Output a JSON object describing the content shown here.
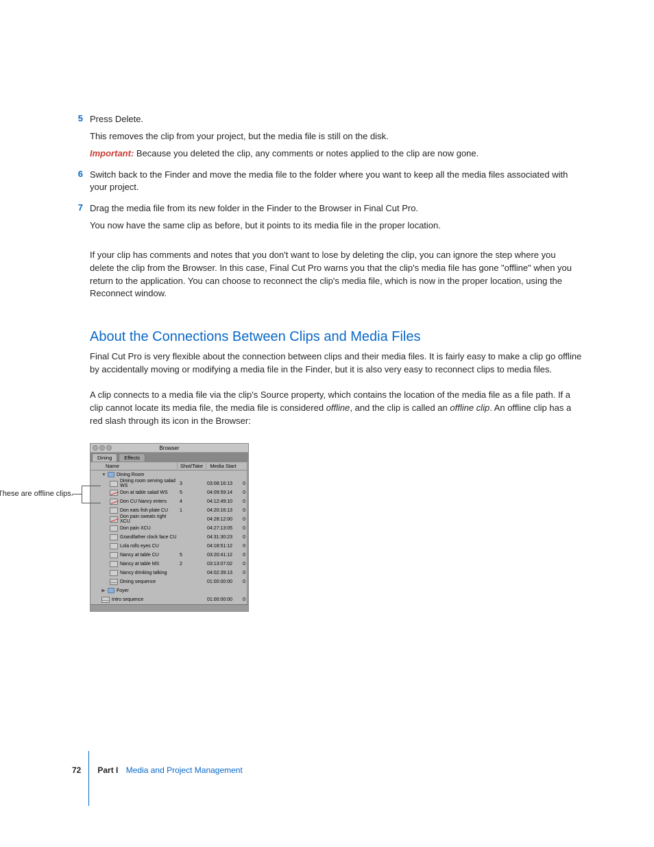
{
  "steps": {
    "s5": {
      "num": "5",
      "line1": "Press Delete.",
      "line2": "This removes the clip from your project, but the media file is still on the disk.",
      "important_label": "Important:",
      "important_text": "  Because you deleted the clip, any comments or notes applied to the clip are now gone."
    },
    "s6": {
      "num": "6",
      "line1": "Switch back to the Finder and move the media file to the folder where you want to keep all the media files associated with your project."
    },
    "s7": {
      "num": "7",
      "line1": "Drag the media file from its new folder in the Finder to the Browser in Final Cut Pro.",
      "line2": "You now have the same clip as before, but it points to its media file in the proper location."
    }
  },
  "para1": "If your clip has comments and notes that you don't want to lose by deleting the clip, you can ignore the step where you delete the clip from the Browser. In this case, Final Cut Pro warns you that the clip's media file has gone \"offline\" when you return to the application. You can choose to reconnect the clip's media file, which is now in the proper location, using the Reconnect window.",
  "heading": "About the Connections Between Clips and Media Files",
  "para2": "Final Cut Pro is very flexible about the connection between clips and their media files. It is fairly easy to make a clip go offline by accidentally moving or modifying a media file in the Finder, but it is also very easy to reconnect clips to media files.",
  "para3a": "A clip connects to a media file via the clip's Source property, which contains the location of the media file as a file path. If a clip cannot locate its media file, the media file is considered ",
  "para3b": "offline",
  "para3c": ", and the clip is called an ",
  "para3d": "offline clip",
  "para3e": ". An offline clip has a red slash through its icon in the Browser:",
  "callout": "These are offline clips.",
  "browser": {
    "title": "Browser",
    "tab1": "Dining",
    "tab2": "Effects",
    "cols": {
      "name": "Name",
      "shot": "Shot/Take",
      "start": "Media Start"
    },
    "rows": [
      {
        "type": "folder",
        "indent": 1,
        "disc": "▼",
        "name": "Dining Room",
        "shot": "",
        "start": "",
        "m": ""
      },
      {
        "type": "clip",
        "indent": 2,
        "off": false,
        "name": "Dining room serving salad WS",
        "shot": "3",
        "start": "03:08:16:13",
        "m": "0"
      },
      {
        "type": "clip",
        "indent": 2,
        "off": true,
        "name": "Don at table salad WS",
        "shot": "5",
        "start": "04:09:59:14",
        "m": "0"
      },
      {
        "type": "clip",
        "indent": 2,
        "off": true,
        "name": "Don CU Nancy enters",
        "shot": "4",
        "start": "04:12:49:10",
        "m": "0"
      },
      {
        "type": "clip",
        "indent": 2,
        "off": false,
        "name": "Don eats fish plate CU",
        "shot": "1",
        "start": "04:20:16:13",
        "m": "0"
      },
      {
        "type": "clip",
        "indent": 2,
        "off": true,
        "name": "Don pain sweats right XCU",
        "shot": "",
        "start": "04:28:12:00",
        "m": "0"
      },
      {
        "type": "clip",
        "indent": 2,
        "off": false,
        "name": "Don pain XCU",
        "shot": "",
        "start": "04:27:13:05",
        "m": "0"
      },
      {
        "type": "clip",
        "indent": 2,
        "off": false,
        "name": "Grandfather clock face CU",
        "shot": "",
        "start": "04:31:30:23",
        "m": "0"
      },
      {
        "type": "clip",
        "indent": 2,
        "off": false,
        "name": "Lola rolls eyes CU",
        "shot": "",
        "start": "04:18:51:12",
        "m": "0"
      },
      {
        "type": "clip",
        "indent": 2,
        "off": false,
        "name": "Nancy at table CU",
        "shot": "5",
        "start": "03:20:41:12",
        "m": "0"
      },
      {
        "type": "clip",
        "indent": 2,
        "off": false,
        "name": "Nancy at table MS",
        "shot": "2",
        "start": "03:13:07:02",
        "m": "0"
      },
      {
        "type": "clip",
        "indent": 2,
        "off": false,
        "name": "Nancy drinking talking",
        "shot": "",
        "start": "04:02:39:13",
        "m": "0"
      },
      {
        "type": "seq",
        "indent": 2,
        "name": "Dining sequence",
        "shot": "",
        "start": "01:00:00:00",
        "m": "0"
      },
      {
        "type": "folder",
        "indent": 1,
        "disc": "▶",
        "name": "Foyer",
        "shot": "",
        "start": "",
        "m": ""
      },
      {
        "type": "seq",
        "indent": 1,
        "name": "Intro sequence",
        "shot": "",
        "start": "01:00:00:00",
        "m": "0"
      }
    ]
  },
  "footer": {
    "page": "72",
    "part": "Part I",
    "title": "Media and Project Management"
  }
}
